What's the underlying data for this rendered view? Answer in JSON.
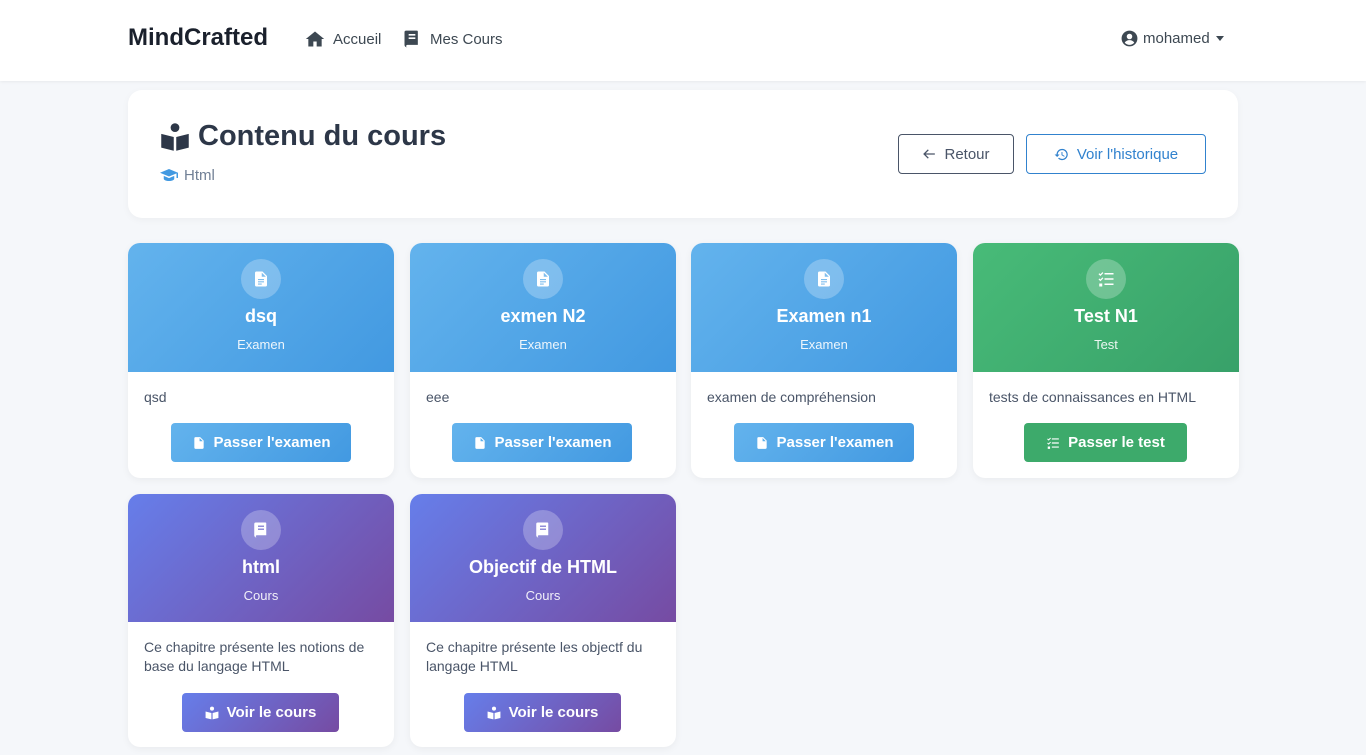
{
  "navbar": {
    "brand": "MindCrafted",
    "links": [
      {
        "label": "Accueil",
        "icon": "home-icon"
      },
      {
        "label": "Mes Cours",
        "icon": "book-icon"
      }
    ],
    "user": "mohamed"
  },
  "header": {
    "title": "Contenu du cours",
    "course": "Html",
    "back_label": "Retour",
    "history_label": "Voir l'historique"
  },
  "cards": [
    {
      "title": "dsq",
      "type": "Examen",
      "description": "qsd",
      "button": "Passer l'examen",
      "theme": "blue",
      "icon": "file-icon"
    },
    {
      "title": "exmen N2",
      "type": "Examen",
      "description": "eee",
      "button": "Passer l'examen",
      "theme": "blue",
      "icon": "file-icon"
    },
    {
      "title": "Examen n1",
      "type": "Examen",
      "description": "examen de compréhension",
      "button": "Passer l'examen",
      "theme": "blue",
      "icon": "file-icon"
    },
    {
      "title": "Test N1",
      "type": "Test",
      "description": "tests de connaissances en HTML",
      "button": "Passer le test",
      "theme": "green",
      "icon": "checklist-icon"
    },
    {
      "title": "html",
      "type": "Cours",
      "description": "Ce chapitre présente les notions de base du langage HTML",
      "button": "Voir le cours",
      "theme": "purple",
      "icon": "book-icon"
    },
    {
      "title": "Objectif de HTML",
      "type": "Cours",
      "description": "Ce chapitre présente les objectf du langage HTML",
      "button": "Voir le cours",
      "theme": "purple",
      "icon": "book-icon"
    }
  ],
  "colors": {
    "exam": "#4299e1",
    "test": "#38a169",
    "course_start": "#667eea",
    "course_end": "#764ba2"
  }
}
